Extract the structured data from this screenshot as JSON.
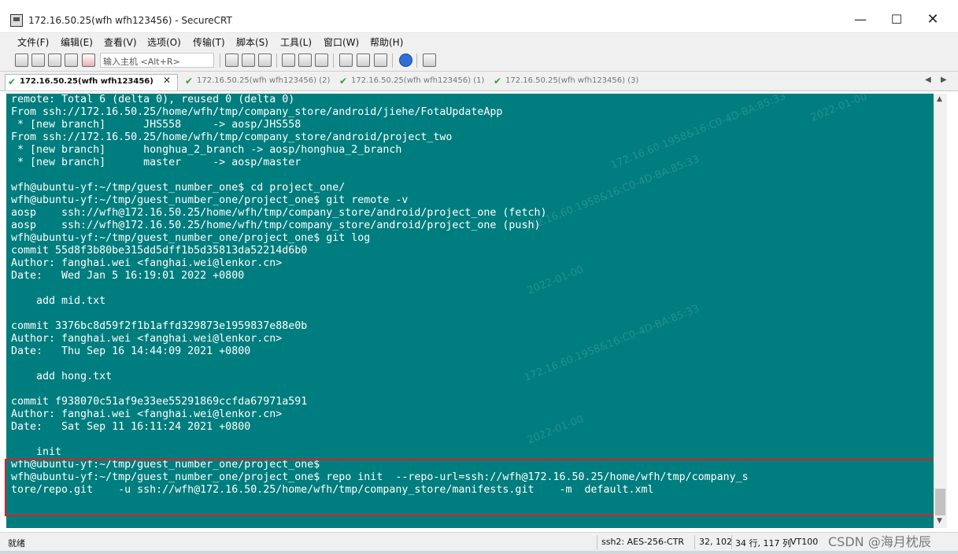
{
  "window": {
    "title": "172.16.50.25(wfh wfh123456) - SecureCRT",
    "minimize": "—",
    "maximize": "☐",
    "close": "✕"
  },
  "menu": [
    "文件(F)",
    "编辑(E)",
    "查看(V)",
    "选项(O)",
    "传输(T)",
    "脚本(S)",
    "工具(L)",
    "窗口(W)",
    "帮助(H)"
  ],
  "toolbar": {
    "host_placeholder": "输入主机 <Alt+R>"
  },
  "tabs": [
    {
      "label": "172.16.50.25(wfh wfh123456)",
      "active": true
    },
    {
      "label": "172.16.50.25(wfh wfh123456) (2)",
      "active": false
    },
    {
      "label": "172.16.50.25(wfh wfh123456) (1)",
      "active": false
    },
    {
      "label": "172.16.50.25(wfh wfh123456) (3)",
      "active": false
    }
  ],
  "terminal": {
    "lines": [
      "remote: Total 6 (delta 0), reused 0 (delta 0)",
      "From ssh://172.16.50.25/home/wfh/tmp/company_store/android/jiehe/FotaUpdateApp",
      " * [new branch]      JHS558     -> aosp/JHS558",
      "From ssh://172.16.50.25/home/wfh/tmp/company_store/android/project_two",
      " * [new branch]      honghua_2_branch -> aosp/honghua_2_branch",
      " * [new branch]      master     -> aosp/master",
      "",
      "wfh@ubuntu-yf:~/tmp/guest_number_one$ cd project_one/",
      "wfh@ubuntu-yf:~/tmp/guest_number_one/project_one$ git remote -v",
      "aosp    ssh://wfh@172.16.50.25/home/wfh/tmp/company_store/android/project_one (fetch)",
      "aosp    ssh://wfh@172.16.50.25/home/wfh/tmp/company_store/android/project_one (push)",
      "wfh@ubuntu-yf:~/tmp/guest_number_one/project_one$ git log",
      "commit 55d8f3b80be315dd5dff1b5d35813da52214d6b0",
      "Author: fanghai.wei <fanghai.wei@lenkor.cn>",
      "Date:   Wed Jan 5 16:19:01 2022 +0800",
      "",
      "    add mid.txt",
      "",
      "commit 3376bc8d59f2f1b1affd329873e1959837e88e0b",
      "Author: fanghai.wei <fanghai.wei@lenkor.cn>",
      "Date:   Thu Sep 16 14:44:09 2021 +0800",
      "",
      "    add hong.txt",
      "",
      "commit f938070c51af9e33ee55291869ccfda67971a591",
      "Author: fanghai.wei <fanghai.wei@lenkor.cn>",
      "Date:   Sat Sep 11 16:11:24 2021 +0800",
      "",
      "    init",
      "wfh@ubuntu-yf:~/tmp/guest_number_one/project_one$",
      "wfh@ubuntu-yf:~/tmp/guest_number_one/project_one$ repo init  --repo-url=ssh://wfh@172.16.50.25/home/wfh/tmp/company_s",
      "tore/repo.git    -u ssh://wfh@172.16.50.25/home/wfh/tmp/company_store/manifests.git    -m  default.xml"
    ],
    "background": "#007d7e"
  },
  "statusbar": {
    "ready": "就绪",
    "cipher": "ssh2: AES-256-CTR",
    "cursor": "32, 102",
    "size": "34 行, 117 列",
    "emulation": "VT100",
    "watermark": "CSDN @海月枕辰"
  }
}
